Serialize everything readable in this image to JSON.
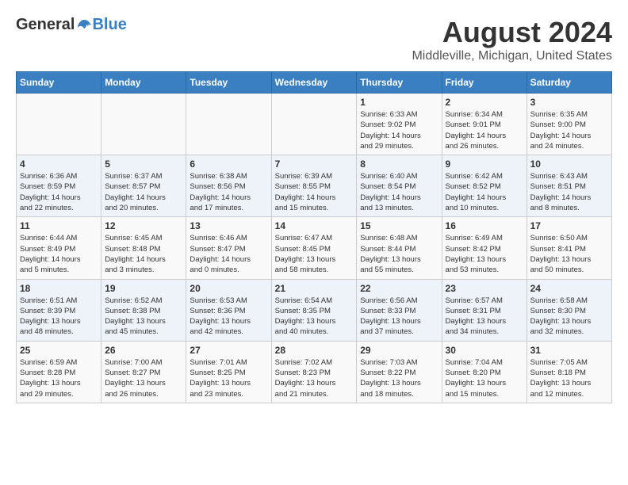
{
  "header": {
    "logo_general": "General",
    "logo_blue": "Blue",
    "month_title": "August 2024",
    "location": "Middleville, Michigan, United States"
  },
  "weekdays": [
    "Sunday",
    "Monday",
    "Tuesday",
    "Wednesday",
    "Thursday",
    "Friday",
    "Saturday"
  ],
  "weeks": [
    [
      {
        "day": "",
        "info": ""
      },
      {
        "day": "",
        "info": ""
      },
      {
        "day": "",
        "info": ""
      },
      {
        "day": "",
        "info": ""
      },
      {
        "day": "1",
        "info": "Sunrise: 6:33 AM\nSunset: 9:02 PM\nDaylight: 14 hours\nand 29 minutes."
      },
      {
        "day": "2",
        "info": "Sunrise: 6:34 AM\nSunset: 9:01 PM\nDaylight: 14 hours\nand 26 minutes."
      },
      {
        "day": "3",
        "info": "Sunrise: 6:35 AM\nSunset: 9:00 PM\nDaylight: 14 hours\nand 24 minutes."
      }
    ],
    [
      {
        "day": "4",
        "info": "Sunrise: 6:36 AM\nSunset: 8:59 PM\nDaylight: 14 hours\nand 22 minutes."
      },
      {
        "day": "5",
        "info": "Sunrise: 6:37 AM\nSunset: 8:57 PM\nDaylight: 14 hours\nand 20 minutes."
      },
      {
        "day": "6",
        "info": "Sunrise: 6:38 AM\nSunset: 8:56 PM\nDaylight: 14 hours\nand 17 minutes."
      },
      {
        "day": "7",
        "info": "Sunrise: 6:39 AM\nSunset: 8:55 PM\nDaylight: 14 hours\nand 15 minutes."
      },
      {
        "day": "8",
        "info": "Sunrise: 6:40 AM\nSunset: 8:54 PM\nDaylight: 14 hours\nand 13 minutes."
      },
      {
        "day": "9",
        "info": "Sunrise: 6:42 AM\nSunset: 8:52 PM\nDaylight: 14 hours\nand 10 minutes."
      },
      {
        "day": "10",
        "info": "Sunrise: 6:43 AM\nSunset: 8:51 PM\nDaylight: 14 hours\nand 8 minutes."
      }
    ],
    [
      {
        "day": "11",
        "info": "Sunrise: 6:44 AM\nSunset: 8:49 PM\nDaylight: 14 hours\nand 5 minutes."
      },
      {
        "day": "12",
        "info": "Sunrise: 6:45 AM\nSunset: 8:48 PM\nDaylight: 14 hours\nand 3 minutes."
      },
      {
        "day": "13",
        "info": "Sunrise: 6:46 AM\nSunset: 8:47 PM\nDaylight: 14 hours\nand 0 minutes."
      },
      {
        "day": "14",
        "info": "Sunrise: 6:47 AM\nSunset: 8:45 PM\nDaylight: 13 hours\nand 58 minutes."
      },
      {
        "day": "15",
        "info": "Sunrise: 6:48 AM\nSunset: 8:44 PM\nDaylight: 13 hours\nand 55 minutes."
      },
      {
        "day": "16",
        "info": "Sunrise: 6:49 AM\nSunset: 8:42 PM\nDaylight: 13 hours\nand 53 minutes."
      },
      {
        "day": "17",
        "info": "Sunrise: 6:50 AM\nSunset: 8:41 PM\nDaylight: 13 hours\nand 50 minutes."
      }
    ],
    [
      {
        "day": "18",
        "info": "Sunrise: 6:51 AM\nSunset: 8:39 PM\nDaylight: 13 hours\nand 48 minutes."
      },
      {
        "day": "19",
        "info": "Sunrise: 6:52 AM\nSunset: 8:38 PM\nDaylight: 13 hours\nand 45 minutes."
      },
      {
        "day": "20",
        "info": "Sunrise: 6:53 AM\nSunset: 8:36 PM\nDaylight: 13 hours\nand 42 minutes."
      },
      {
        "day": "21",
        "info": "Sunrise: 6:54 AM\nSunset: 8:35 PM\nDaylight: 13 hours\nand 40 minutes."
      },
      {
        "day": "22",
        "info": "Sunrise: 6:56 AM\nSunset: 8:33 PM\nDaylight: 13 hours\nand 37 minutes."
      },
      {
        "day": "23",
        "info": "Sunrise: 6:57 AM\nSunset: 8:31 PM\nDaylight: 13 hours\nand 34 minutes."
      },
      {
        "day": "24",
        "info": "Sunrise: 6:58 AM\nSunset: 8:30 PM\nDaylight: 13 hours\nand 32 minutes."
      }
    ],
    [
      {
        "day": "25",
        "info": "Sunrise: 6:59 AM\nSunset: 8:28 PM\nDaylight: 13 hours\nand 29 minutes."
      },
      {
        "day": "26",
        "info": "Sunrise: 7:00 AM\nSunset: 8:27 PM\nDaylight: 13 hours\nand 26 minutes."
      },
      {
        "day": "27",
        "info": "Sunrise: 7:01 AM\nSunset: 8:25 PM\nDaylight: 13 hours\nand 23 minutes."
      },
      {
        "day": "28",
        "info": "Sunrise: 7:02 AM\nSunset: 8:23 PM\nDaylight: 13 hours\nand 21 minutes."
      },
      {
        "day": "29",
        "info": "Sunrise: 7:03 AM\nSunset: 8:22 PM\nDaylight: 13 hours\nand 18 minutes."
      },
      {
        "day": "30",
        "info": "Sunrise: 7:04 AM\nSunset: 8:20 PM\nDaylight: 13 hours\nand 15 minutes."
      },
      {
        "day": "31",
        "info": "Sunrise: 7:05 AM\nSunset: 8:18 PM\nDaylight: 13 hours\nand 12 minutes."
      }
    ]
  ]
}
